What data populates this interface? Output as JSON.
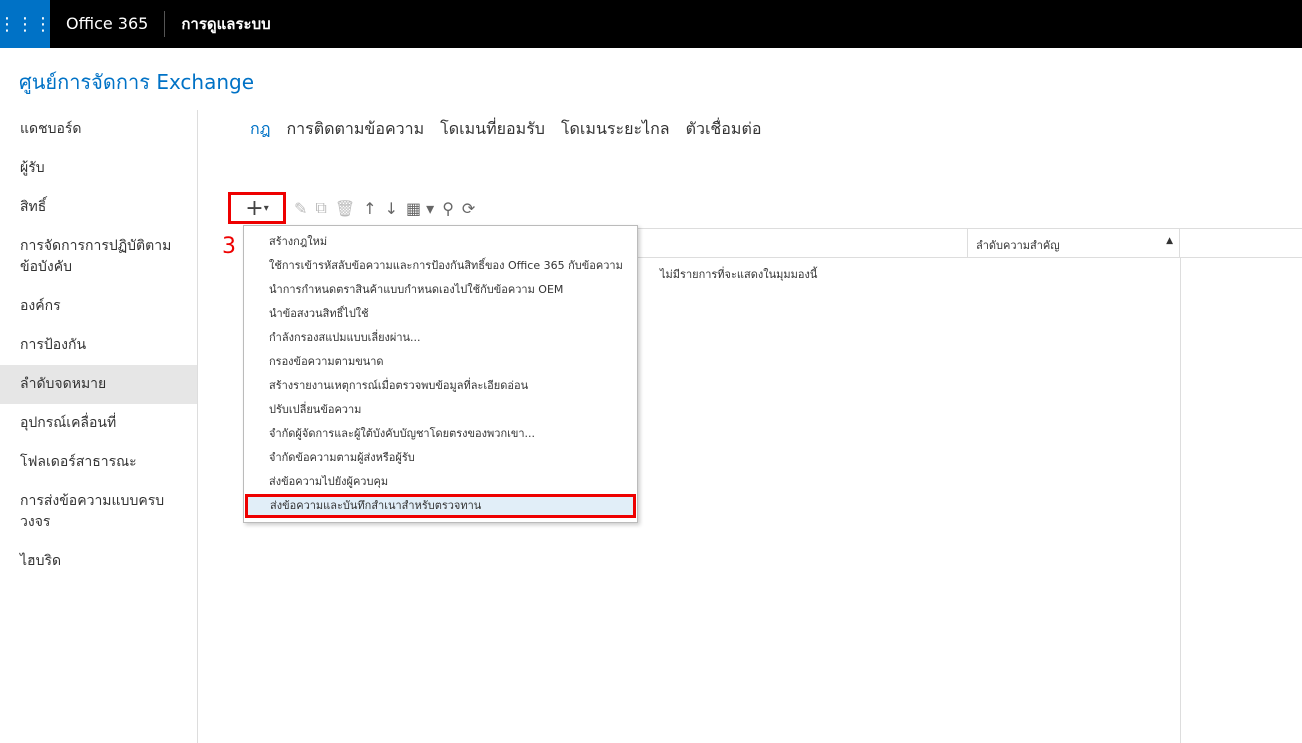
{
  "topbar": {
    "brand": "Office 365",
    "app": "การดูแลระบบ"
  },
  "title": "ศูนย์การจัดการ Exchange",
  "sidebar": {
    "items": [
      {
        "label": "แดชบอร์ด"
      },
      {
        "label": "ผู้รับ"
      },
      {
        "label": "สิทธิ์"
      },
      {
        "label": "การจัดการการปฏิบัติตามข้อบังคับ"
      },
      {
        "label": "องค์กร"
      },
      {
        "label": "การป้องกัน"
      },
      {
        "label": "ลำดับจดหมาย",
        "active": true
      },
      {
        "label": "อุปกรณ์เคลื่อนที่"
      },
      {
        "label": "โฟลเดอร์สาธารณะ"
      },
      {
        "label": "การส่งข้อความแบบครบวงจร"
      },
      {
        "label": "ไฮบริด"
      }
    ]
  },
  "tabs": [
    {
      "label": "กฎ",
      "active": true
    },
    {
      "label": "การติดตามข้อความ"
    },
    {
      "label": "โดเมนที่ยอมรับ"
    },
    {
      "label": "โดเมนระยะไกล"
    },
    {
      "label": "ตัวเชื่อมต่อ"
    }
  ],
  "toolbar": {
    "add": "+",
    "add_caret": "▾",
    "icons": [
      "edit-icon",
      "copy-icon",
      "delete-icon",
      "move-up-icon",
      "move-down-icon",
      "report-icon",
      "search-icon",
      "refresh-icon"
    ]
  },
  "step_label": "3",
  "table": {
    "column_priority": "ลำดับความสำคัญ",
    "sort": "▲",
    "empty": "ไม่มีรายการที่จะแสดงในมุมมองนี้"
  },
  "menu": {
    "items": [
      "สร้างกฎใหม่",
      "ใช้การเข้ารหัสลับข้อความและการป้องกันสิทธิ์ของ Office 365 กับข้อความ",
      "นำการกำหนดตราสินค้าแบบกำหนดเองไปใช้กับข้อความ OEM",
      "นำข้อสงวนสิทธิ์ไปใช้",
      "กำลังกรองสแปมแบบเลี่ยงผ่าน...",
      "กรองข้อความตามขนาด",
      "สร้างรายงานเหตุการณ์เมื่อตรวจพบข้อมูลที่ละเอียดอ่อน",
      "ปรับเปลี่ยนข้อความ",
      "จำกัดผู้จัดการและผู้ใต้บังคับบัญชาโดยตรงของพวกเขา...",
      "จำกัดข้อความตามผู้ส่งหรือผู้รับ",
      "ส่งข้อความไปยังผู้ควบคุม",
      "ส่งข้อความและบันทึกสำเนาสำหรับตรวจทาน"
    ],
    "selected_index": 11
  },
  "colors": {
    "accent": "#0072c6",
    "highlight": "#e00000"
  }
}
